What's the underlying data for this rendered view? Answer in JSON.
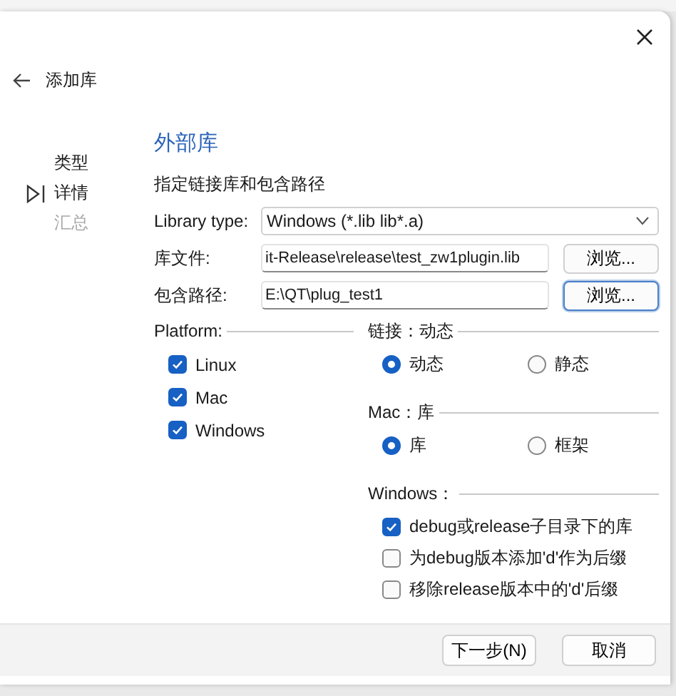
{
  "window": {
    "title": "添加库"
  },
  "steps": [
    {
      "label": "类型",
      "selected": false,
      "disabled": false
    },
    {
      "label": "详情",
      "selected": true,
      "disabled": false
    },
    {
      "label": "汇总",
      "selected": false,
      "disabled": true
    }
  ],
  "page": {
    "heading": "外部库",
    "description": "指定链接库和包含路径"
  },
  "form": {
    "library_type": {
      "label": "Library type:",
      "value": "Windows (*.lib lib*.a)"
    },
    "fields": [
      {
        "label": "库文件:",
        "value": "it-Release\\release\\test_zw1plugin.lib",
        "button": "浏览...",
        "focused": false
      },
      {
        "label": "包含路径:",
        "value": "E:\\QT\\plug_test1",
        "button": "浏览...",
        "focused": true
      }
    ]
  },
  "platform": {
    "title": "Platform:",
    "items": [
      {
        "label": "Linux",
        "checked": true
      },
      {
        "label": "Mac",
        "checked": true
      },
      {
        "label": "Windows",
        "checked": true
      }
    ]
  },
  "linking": {
    "title": "链接：动态",
    "options": [
      {
        "label": "动态",
        "selected": true
      },
      {
        "label": "静态",
        "selected": false
      }
    ]
  },
  "mac": {
    "title": "Mac：库",
    "options": [
      {
        "label": "库",
        "selected": true
      },
      {
        "label": "框架",
        "selected": false
      }
    ]
  },
  "windows": {
    "title": "Windows：",
    "items": [
      {
        "label": "debug或release子目录下的库",
        "checked": true
      },
      {
        "label": "为debug版本添加'd'作为后缀",
        "checked": false
      },
      {
        "label": "移除release版本中的'd'后缀",
        "checked": false
      }
    ]
  },
  "buttons": [
    {
      "label": "下一步(N)"
    },
    {
      "label": "取消"
    }
  ]
}
